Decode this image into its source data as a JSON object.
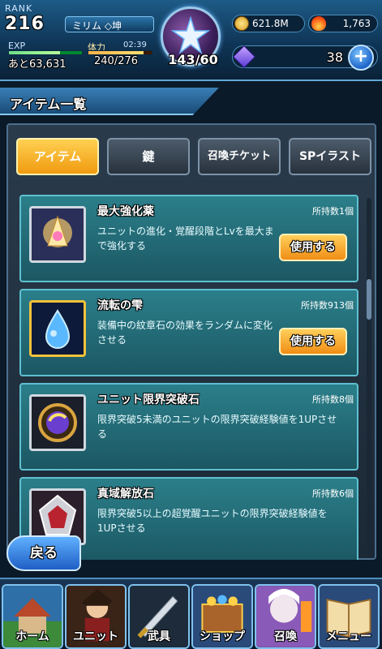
{
  "header": {
    "rank_label": "RANK",
    "rank_value": "216",
    "player_name": "ミリム ◇坤",
    "exp_label": "EXP",
    "exp_value": "あと63,631",
    "exp_progress": 0.7,
    "stamina_label": "体力",
    "stamina_timer": "02:39",
    "stamina_value": "240/276",
    "stamina_progress": 0.87,
    "stage_count": "143/60",
    "coins": "621.8M",
    "souls": "1,763",
    "gems": "38",
    "plus_label": "+"
  },
  "title": "アイテム一覧",
  "tabs": [
    {
      "label": "アイテム",
      "active": true
    },
    {
      "label": "鍵",
      "active": false
    },
    {
      "label": "召喚チケット",
      "active": false
    },
    {
      "label": "SPイラスト",
      "active": false
    }
  ],
  "items": [
    {
      "name": "最大強化薬",
      "count": "所持数1個",
      "desc": "ユニットの進化・覚醒段階とLvを最大まで強化する",
      "button": "使用する",
      "icon": "potion-icon"
    },
    {
      "name": "流転の雫",
      "count": "所持数913個",
      "desc": "装備中の紋章石の効果をランダムに変化させる",
      "button": "使用する",
      "icon": "drop-icon"
    },
    {
      "name": "ユニット限界突破石",
      "count": "所持数8個",
      "desc": "限界突破5未満のユニットの限界突破経験値を1UPさせる",
      "icon": "orb-icon"
    },
    {
      "name": "真域解放石",
      "count": "所持数6個",
      "desc": "限界突破5以上の超覚醒ユニットの限界突破経験値を1UPさせる",
      "icon": "gem-stone-icon"
    }
  ],
  "back_label": "戻る",
  "nav": [
    {
      "label": "ホーム",
      "icon": "home-icon"
    },
    {
      "label": "ユニット",
      "icon": "unit-icon"
    },
    {
      "label": "武具",
      "icon": "weapon-icon"
    },
    {
      "label": "ショップ",
      "icon": "shop-icon"
    },
    {
      "label": "召喚",
      "icon": "summon-icon"
    },
    {
      "label": "メニュー",
      "icon": "menu-icon"
    }
  ],
  "colors": {
    "accent_blue": "#4d8fbd",
    "tab_active": "#f09b10",
    "item_panel": "#2b7f8a",
    "use_button": "#f08d15"
  }
}
